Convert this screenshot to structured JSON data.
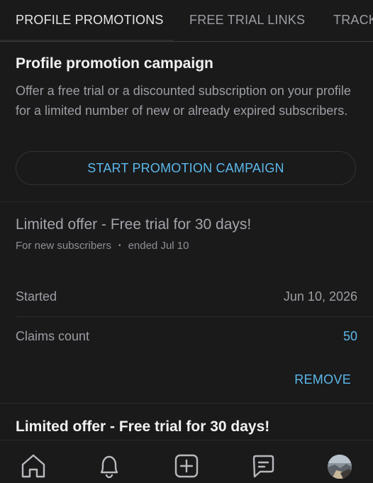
{
  "tabs": [
    {
      "label": "PROFILE PROMOTIONS",
      "active": true
    },
    {
      "label": "FREE TRIAL LINKS",
      "active": false
    },
    {
      "label": "TRACK",
      "active": false
    }
  ],
  "campaign": {
    "title": "Profile promotion campaign",
    "description": "Offer a free trial or a discounted subscription on your profile for a limited number of new or already expired subscribers.",
    "button_label": "START PROMOTION CAMPAIGN"
  },
  "offers": [
    {
      "title": "Limited offer - Free trial for 30 days!",
      "audience": "For new subscribers",
      "status": "ended Jul 10",
      "rows": [
        {
          "label": "Started",
          "value": "Jun 10, 2026"
        },
        {
          "label": "Claims count",
          "value": "50"
        }
      ],
      "remove_label": "REMOVE"
    },
    {
      "title": "Limited offer - Free trial for 30 days!"
    }
  ],
  "bottom_nav": {
    "items": [
      "home-icon",
      "bell-icon",
      "add-post-icon",
      "messages-icon",
      "avatar"
    ]
  },
  "colors": {
    "background": "#1a1a1b",
    "accent": "#5cb8ea",
    "muted_text": "#9c9ea3"
  }
}
